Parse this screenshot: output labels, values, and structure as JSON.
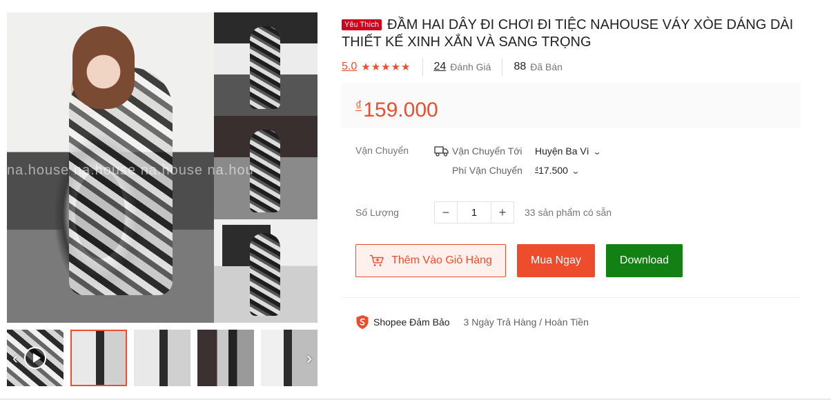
{
  "gallery": {
    "watermark": "na.house  na.house  na.house  na.hou",
    "thumbnails": [
      {
        "name": "video-thumbnail",
        "has_video": true
      },
      {
        "name": "collage-thumbnail",
        "active": true
      },
      {
        "name": "photo-thumbnail-2"
      },
      {
        "name": "photo-thumbnail-3"
      },
      {
        "name": "photo-thumbnail-4"
      }
    ],
    "prev_arrow": "‹",
    "next_arrow": "›"
  },
  "product": {
    "badge": "Yêu Thích",
    "title": "ĐẦM HAI DÂY ĐI CHƠI ĐI TIỆC NAHOUSE VÁY XÒE DÁNG DÀI THIẾT KẾ XINH XẮN VÀ SANG TRỌNG",
    "rating": "5.0",
    "stars": "★★★★★",
    "review_count": "24",
    "review_label": "Đánh Giá",
    "sold_count": "88",
    "sold_label": "Đã Bán",
    "price_currency": "₫",
    "price": "159.000"
  },
  "shipping": {
    "label": "Vận Chuyển",
    "to_label": "Vận Chuyển Tới",
    "to_value": "Huyện Ba Vì",
    "fee_label": "Phí Vận Chuyển",
    "fee_currency": "₫",
    "fee_value": "17.500"
  },
  "quantity": {
    "label": "Số Lượng",
    "minus": "−",
    "value": "1",
    "plus": "+",
    "stock": "33 sản phẩm có sẵn"
  },
  "actions": {
    "add_to_cart": "Thêm Vào Giỏ Hàng",
    "buy_now": "Mua Ngay",
    "download": "Download"
  },
  "guarantee": {
    "brand": "Shopee Đảm Bảo",
    "text": "3 Ngày Trả Hàng / Hoàn Tiền"
  },
  "colors": {
    "accent": "#ee4d2d",
    "badge": "#d0011b",
    "download": "#128012",
    "price_bg": "#fafafa"
  },
  "icons": [
    "play-icon",
    "truck-icon",
    "chevron-down-icon",
    "cart-icon",
    "shield-icon",
    "star-icon"
  ]
}
